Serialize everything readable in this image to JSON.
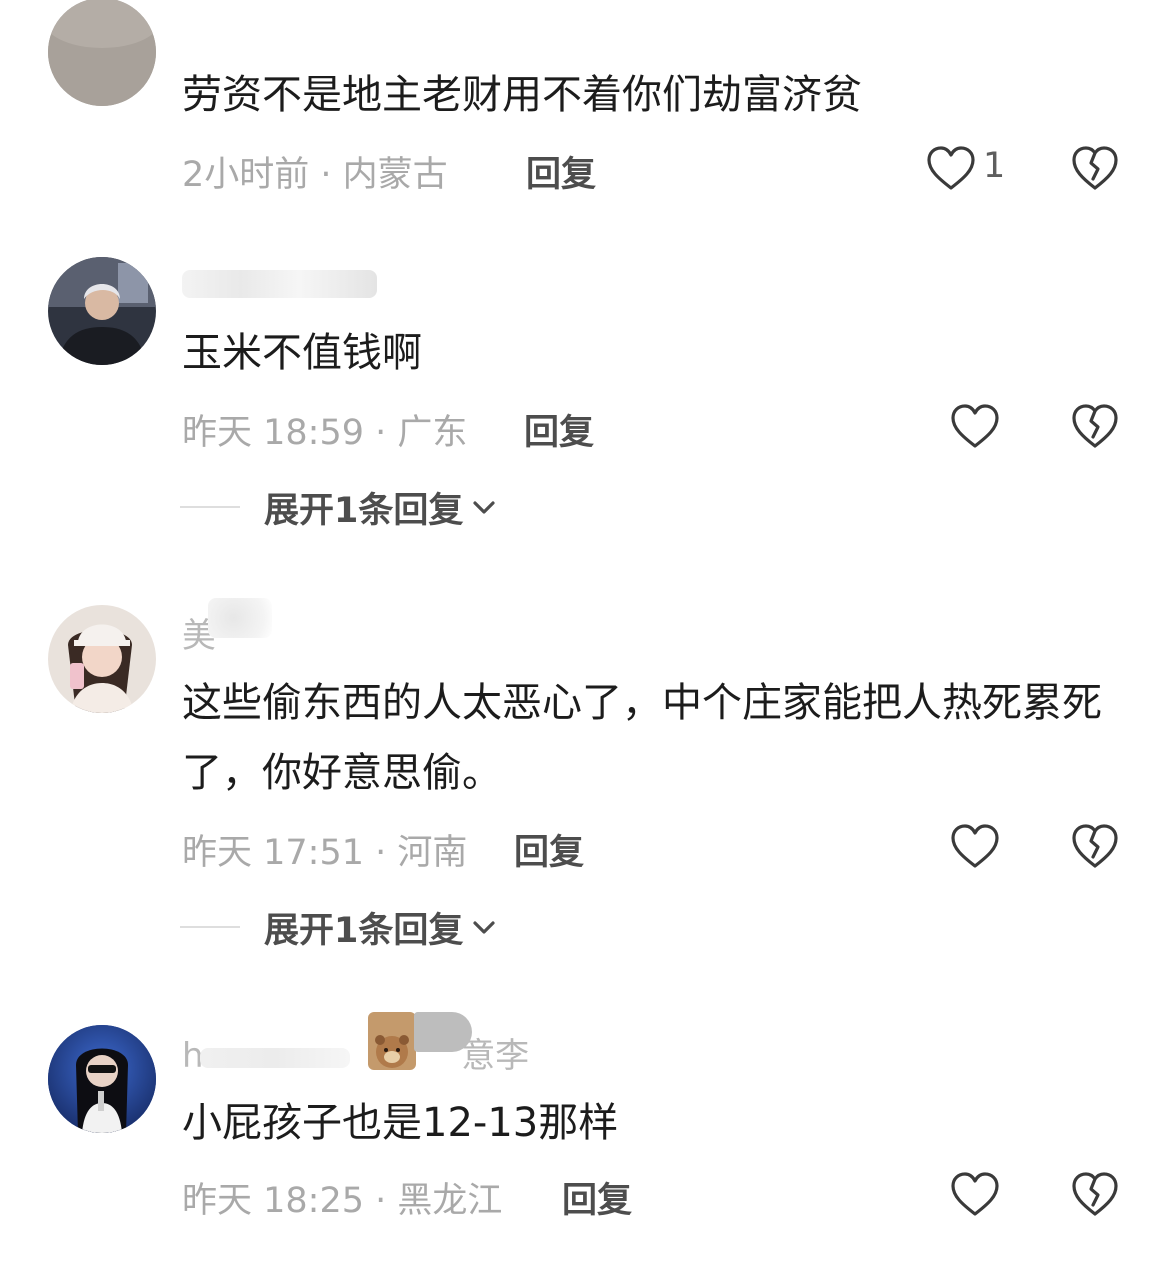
{
  "comments": [
    {
      "username": "",
      "text": "劳资不是地主老财用不着你们劫富济贫",
      "time_location": "2小时前 · 内蒙古",
      "reply_label": "回复",
      "like_count": "1",
      "expand_label": ""
    },
    {
      "username": "",
      "text": "玉米不值钱啊",
      "time_location": "昨天 18:59 · 广东",
      "reply_label": "回复",
      "like_count": "",
      "expand_label": "展开1条回复"
    },
    {
      "username": "美",
      "text": "这些偷东西的人太恶心了，中个庄家能把人热死累死了，你好意思偷。",
      "time_location": "昨天 17:51 · 河南",
      "reply_label": "回复",
      "like_count": "",
      "expand_label": "展开1条回复"
    },
    {
      "username": "h",
      "username_suffix": "意李",
      "text": "小屁孩子也是12-13那样",
      "time_location": "昨天 18:25 · 黑龙江",
      "reply_label": "回复",
      "like_count": "",
      "expand_label": ""
    }
  ],
  "icons": {
    "like": "heart-outline-icon",
    "dislike": "broken-heart-icon",
    "expand": "chevron-down-icon"
  },
  "colors": {
    "text": "#1c1c1c",
    "meta": "#a9a9a9",
    "icon": "#3a3a3a"
  }
}
